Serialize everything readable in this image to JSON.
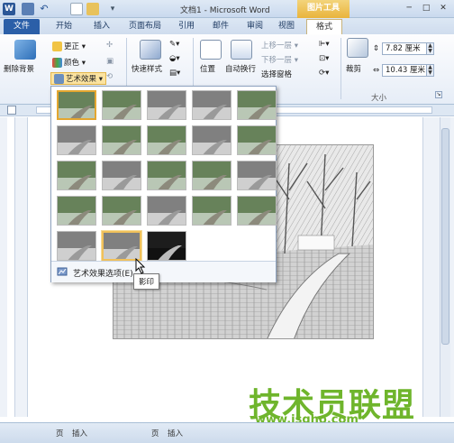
{
  "window": {
    "title": "文档1 - Microsoft Word",
    "contextual_group": "图片工具",
    "app_icon": "W",
    "minimize": "─",
    "maximize": "□",
    "close": "✕"
  },
  "tabs": [
    {
      "label": "文件"
    },
    {
      "label": "开始"
    },
    {
      "label": "插入"
    },
    {
      "label": "页面布局"
    },
    {
      "label": "引用"
    },
    {
      "label": "邮件"
    },
    {
      "label": "审阅"
    },
    {
      "label": "视图"
    },
    {
      "label": "格式",
      "active": true
    }
  ],
  "ribbon": {
    "remove_background": "删除背景",
    "corrections": "更正 ▾",
    "color": "颜色 ▾",
    "artistic_effects": "艺术效果 ▾",
    "quick_styles": "快速样式",
    "position": "位置",
    "wrap_text": "自动换行",
    "bring_forward": "上移一层 ▾",
    "send_backward": "下移一层 ▾",
    "selection_pane": "选择窗格",
    "crop": "裁剪",
    "height_value": "7.82 厘米",
    "width_value": "10.43 厘米",
    "size_group": "大小"
  },
  "gallery": {
    "options_label": "艺术效果选项(E)...",
    "tooltip": "影印",
    "selected_index": 0,
    "hover_index": 21,
    "effects": [
      "none",
      "marker",
      "pencil-grayscale",
      "pencil-sketch",
      "line-drawing",
      "chalk",
      "paint-strokes",
      "paint-brush",
      "glow-diffused",
      "blur",
      "light-screen",
      "watercolor",
      "film-grain",
      "mosaic",
      "plastic-wrap",
      "texturizer",
      "cement",
      "glass",
      "pastels-smooth",
      "cutout",
      "photocopy-color",
      "photocopy",
      "glow-edges"
    ]
  },
  "statusbar": {
    "left": "页",
    "insert": "插入",
    "page_mode": "页",
    "insert2": "插入"
  },
  "watermark": {
    "text": "技术员联盟",
    "url": "www.jsgho.com"
  },
  "colors": {
    "accent": "#2b5fa8",
    "contextual": "#e9b43c",
    "watermark": "#6fb52c"
  }
}
